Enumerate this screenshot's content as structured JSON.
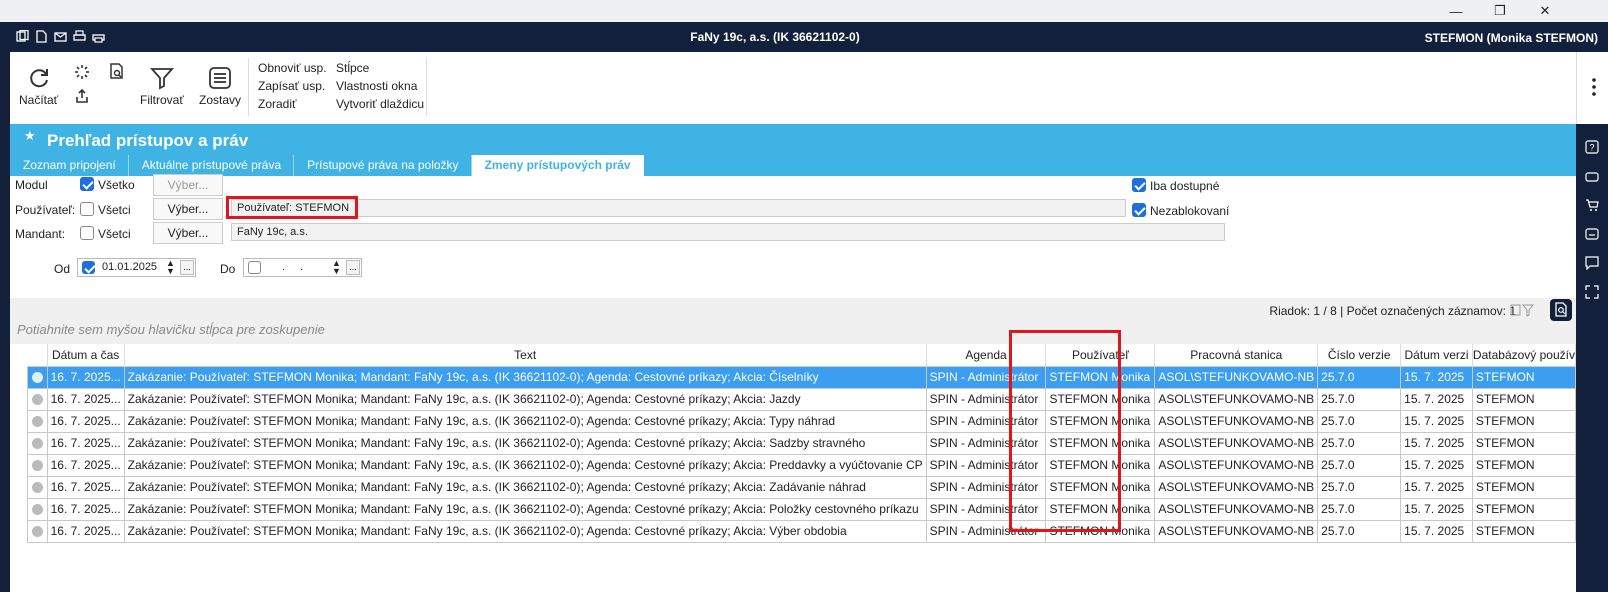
{
  "window": {
    "title": "FaNy 19c, a.s. (IK 36621102-0)",
    "user": "STEFMON (Monika STEFMON)"
  },
  "ribbon": {
    "refresh_label": "Načítať",
    "filter_label": "Filtrovať",
    "reports_label": "Zostavy",
    "col1": [
      "Obnoviť usp.",
      "Zapísať usp.",
      "Zoradiť"
    ],
    "col2": [
      "Stĺpce",
      "Vlastnosti okna",
      "Vytvoriť dlaždicu"
    ]
  },
  "header": {
    "title": "Prehľad prístupov a práv"
  },
  "tabs": [
    {
      "label": "Zoznam pripojení"
    },
    {
      "label": "Aktuálne prístupové práva"
    },
    {
      "label": "Prístupové práva na položky"
    },
    {
      "label": "Zmeny prístupových práv"
    }
  ],
  "form": {
    "modul_label": "Modul",
    "modul_all": "Všetko",
    "modul_select": "Výber...",
    "user_label": "Používateľ:",
    "user_all": "Všetci",
    "user_select": "Výber...",
    "user_value": "Používateľ: STEFMON",
    "mandant_label": "Mandant:",
    "mandant_all": "Všetci",
    "mandant_select": "Výber...",
    "mandant_value": "FaNy 19c, a.s.",
    "od_label": "Od",
    "od_value": "01.01.2025",
    "do_label": "Do",
    "do_value": ". .",
    "only_available": "Iba dostupné",
    "not_blocked": "Nezablokovaní",
    "date_btn": "..."
  },
  "grid": {
    "status": "Riadok: 1 / 8 | Počet označených záznamov: 1",
    "group_hint": "Potiahnite sem myšou hlavičku stĺpca pre zoskupenie",
    "columns": [
      "",
      "Dátum a čas",
      "Text",
      "Agenda",
      "Používateľ",
      "Pracovná stanica",
      "Číslo verzie",
      "Dátum verzi",
      "Databázový použív"
    ],
    "rows": [
      [
        "16. 7. 2025...",
        "Zakázanie: Používateľ: STEFMON Monika; Mandant: FaNy 19c, a.s. (IK 36621102-0); Agenda: Cestovné príkazy; Akcia: Číselníky",
        "SPIN - Administrátor",
        "STEFMON Monika",
        "ASOL\\STEFUNKOVAMO-NB",
        "25.7.0",
        "15. 7. 2025",
        "STEFMON"
      ],
      [
        "16. 7. 2025...",
        "Zakázanie: Používateľ: STEFMON Monika; Mandant: FaNy 19c, a.s. (IK 36621102-0); Agenda: Cestovné príkazy; Akcia: Jazdy",
        "SPIN - Administrátor",
        "STEFMON Monika",
        "ASOL\\STEFUNKOVAMO-NB",
        "25.7.0",
        "15. 7. 2025",
        "STEFMON"
      ],
      [
        "16. 7. 2025...",
        "Zakázanie: Používateľ: STEFMON Monika; Mandant: FaNy 19c, a.s. (IK 36621102-0); Agenda: Cestovné príkazy; Akcia: Typy náhrad",
        "SPIN - Administrátor",
        "STEFMON Monika",
        "ASOL\\STEFUNKOVAMO-NB",
        "25.7.0",
        "15. 7. 2025",
        "STEFMON"
      ],
      [
        "16. 7. 2025...",
        "Zakázanie: Používateľ: STEFMON Monika; Mandant: FaNy 19c, a.s. (IK 36621102-0); Agenda: Cestovné príkazy; Akcia: Sadzby stravného",
        "SPIN - Administrátor",
        "STEFMON Monika",
        "ASOL\\STEFUNKOVAMO-NB",
        "25.7.0",
        "15. 7. 2025",
        "STEFMON"
      ],
      [
        "16. 7. 2025...",
        "Zakázanie: Používateľ: STEFMON Monika; Mandant: FaNy 19c, a.s. (IK 36621102-0); Agenda: Cestovné príkazy; Akcia: Preddavky a vyúčtovanie CP",
        "SPIN - Administrátor",
        "STEFMON Monika",
        "ASOL\\STEFUNKOVAMO-NB",
        "25.7.0",
        "15. 7. 2025",
        "STEFMON"
      ],
      [
        "16. 7. 2025...",
        "Zakázanie: Používateľ: STEFMON Monika; Mandant: FaNy 19c, a.s. (IK 36621102-0); Agenda: Cestovné príkazy; Akcia: Zadávanie náhrad",
        "SPIN - Administrátor",
        "STEFMON Monika",
        "ASOL\\STEFUNKOVAMO-NB",
        "25.7.0",
        "15. 7. 2025",
        "STEFMON"
      ],
      [
        "16. 7. 2025...",
        "Zakázanie: Používateľ: STEFMON Monika; Mandant: FaNy 19c, a.s. (IK 36621102-0); Agenda: Cestovné príkazy; Akcia: Položky cestovného príkazu",
        "SPIN - Administrátor",
        "STEFMON Monika",
        "ASOL\\STEFUNKOVAMO-NB",
        "25.7.0",
        "15. 7. 2025",
        "STEFMON"
      ],
      [
        "16. 7. 2025...",
        "Zakázanie: Používateľ: STEFMON Monika; Mandant: FaNy 19c, a.s. (IK 36621102-0); Agenda: Cestovné príkazy; Akcia: Výber obdobia",
        "SPIN - Administrátor",
        "STEFMON Monika",
        "ASOL\\STEFUNKOVAMO-NB",
        "25.7.0",
        "15. 7. 2025",
        "STEFMON"
      ]
    ]
  },
  "colors": {
    "titlebar": "#13203b",
    "header": "#3fb3e4",
    "selection": "#3b9ef0",
    "highlight": "#e4141b"
  }
}
